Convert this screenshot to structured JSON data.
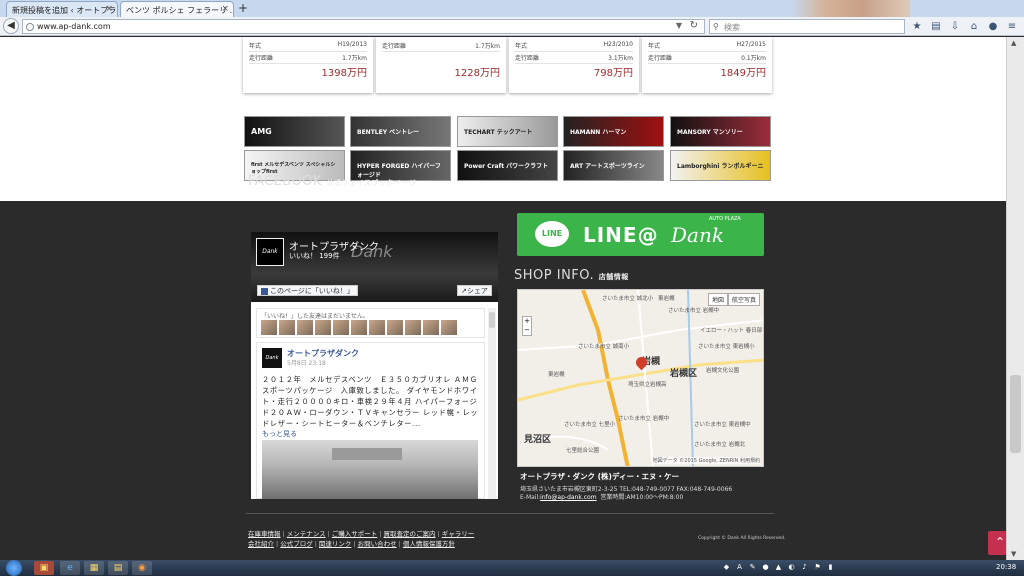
{
  "browser": {
    "tabs": [
      {
        "label": "新規投稿を追加 ‹ オートプラ..."
      },
      {
        "label": "ベンツ ポルシェ フェラーリ ..."
      }
    ],
    "url": "www.ap-dank.com",
    "search_placeholder": "検索"
  },
  "cars": [
    {
      "year_label": "年式",
      "year": "H19/2013",
      "mileage_label": "走行距離",
      "mileage": "1.7万km",
      "price": "1398万円"
    },
    {
      "year_label": "走行距離",
      "year": "1.7万km",
      "mileage_label": "",
      "mileage": "",
      "price": "1228万円"
    },
    {
      "year_label": "年式",
      "year": "H23/2010",
      "mileage_label": "走行距離",
      "mileage": "3.1万km",
      "price": "798万円"
    },
    {
      "year_label": "年式",
      "year": "H27/2015",
      "mileage_label": "走行距離",
      "mileage": "0.1万km",
      "price": "1849万円"
    }
  ],
  "brands": [
    {
      "label": "AMG"
    },
    {
      "label": "BENTLEY ベントレー"
    },
    {
      "label": "TECHART テックアート"
    },
    {
      "label": "HAMANN ハーマン"
    },
    {
      "label": "MANSORY マンソリー"
    },
    {
      "label": "first メルセデスベンツ スペシャルショップfirst"
    },
    {
      "label": "HYPER FORGED ハイパーフォージド"
    },
    {
      "label": "Power Craft パワークラフト"
    },
    {
      "label": "ART アートスポーツライン"
    },
    {
      "label": "Lamborghini ランボルギーニ"
    }
  ],
  "facebook": {
    "heading": "FACEBOOK",
    "subheading": "公式フェイスブックページ",
    "page_name": "オートプラザダンク",
    "likes": "いいね！ 199件",
    "cover_script": "Dank",
    "like_button": "このページに「いいね！」",
    "share_button": "シェア",
    "friends_text": "「いいね！」した友達はまだいません。",
    "post": {
      "author": "オートプラザダンク",
      "date": "5月8日 23:18",
      "text": "２０１２年　メルセデスベンツ　Ｅ３５０カブリオレ ＡＭＧスポーツパッケージ　入庫致しました。 ダイヤモンドホワイト・走行２００００キロ・車検２９年４月 ハイパーフォージド２０ＡＷ・ローダウン・ＴＶキャンセラー レッド幌・レッドレザー・シートヒーター＆ベンチレター...",
      "more": "もっと見る"
    }
  },
  "line": {
    "bubble": "LINE",
    "text": "LINE@",
    "script": "Dank",
    "small": "AUTO PLAZA"
  },
  "shop": {
    "heading": "SHOP INFO.",
    "subheading": "店舗情報",
    "name": "オートプラザ・ダンク (株)ディー・エヌ・ケー",
    "address": "埼玉県さいたま市岩槻区東町2-3-25 TEL:048-749-0077 FAX:048-749-0066",
    "email_label": "E-Mail:",
    "email": "info@ap-dank.com",
    "hours": "営業時間:AM10:00〜PM:8:00"
  },
  "map": {
    "btn_map": "地図",
    "btn_satellite": "航空写真",
    "zoom_in": "+",
    "zoom_out": "−",
    "labels": [
      "さいたま市立 城北小",
      "東岩槻",
      "さいたま市立 岩槻中",
      "イエロー・ハット 春日部",
      "さいたま市立 東岩槻小",
      "さいたま市立 城南小",
      "岩槻区",
      "岩槻文化公園",
      "岩槻",
      "埼玉県立岩槻高",
      "東岩槻",
      "さいたま市立 岩槻中",
      "見沼区",
      "七里総合公園",
      "さいたま市立 七里小",
      "さいたま市立 岩槻北",
      "さいたま市立 東岩槻中"
    ],
    "copyright": "地図データ ©2015 Google, ZENRIN  利用規約"
  },
  "footer": {
    "links_row1": [
      "在庫車情報",
      "メンテナンス",
      "ご購入サポート",
      "買取査定のご案内",
      "ギャラリー"
    ],
    "links_row2": [
      "会社紹介",
      "公式ブログ",
      "関連リンク",
      "お問い合わせ",
      "個人情報保護方針"
    ],
    "copyright": "Copyright © Dank All Rights Reserved.",
    "to_top": "⌃"
  },
  "taskbar": {
    "clock": "20:38"
  }
}
